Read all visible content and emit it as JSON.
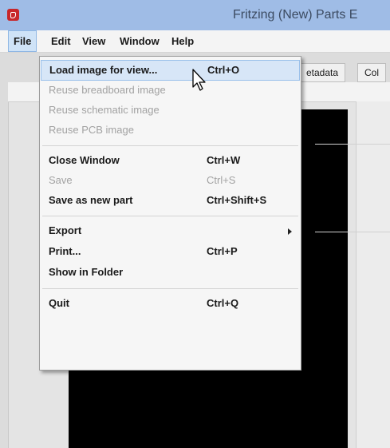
{
  "window": {
    "title": "Fritzing (New) Parts E"
  },
  "menubar": {
    "items": [
      {
        "label": "File"
      },
      {
        "label": "Edit"
      },
      {
        "label": "View"
      },
      {
        "label": "Window"
      },
      {
        "label": "Help"
      }
    ]
  },
  "tabs": [
    {
      "label": "etadata"
    },
    {
      "label": "Col"
    }
  ],
  "file_menu": {
    "items": [
      {
        "label": "Load image for view...",
        "shortcut": "Ctrl+O",
        "enabled": true,
        "highlighted": true
      },
      {
        "label": "Reuse breadboard image",
        "shortcut": "",
        "enabled": false
      },
      {
        "label": "Reuse schematic image",
        "shortcut": "",
        "enabled": false
      },
      {
        "label": "Reuse PCB image",
        "shortcut": "",
        "enabled": false
      },
      {
        "label": "Close Window",
        "shortcut": "Ctrl+W",
        "enabled": true
      },
      {
        "label": "Save",
        "shortcut": "Ctrl+S",
        "enabled": false
      },
      {
        "label": "Save as new part",
        "shortcut": "Ctrl+Shift+S",
        "enabled": true
      },
      {
        "label": "Export",
        "shortcut": "",
        "enabled": true,
        "submenu": true
      },
      {
        "label": "Print...",
        "shortcut": "Ctrl+P",
        "enabled": true
      },
      {
        "label": "Show in Folder",
        "shortcut": "",
        "enabled": true
      },
      {
        "label": "Quit",
        "shortcut": "Ctrl+Q",
        "enabled": true
      }
    ]
  },
  "colors": {
    "titlebar": "#9fbce6",
    "menu_highlight": "#d7e6f7",
    "app_icon": "#c8262a"
  }
}
